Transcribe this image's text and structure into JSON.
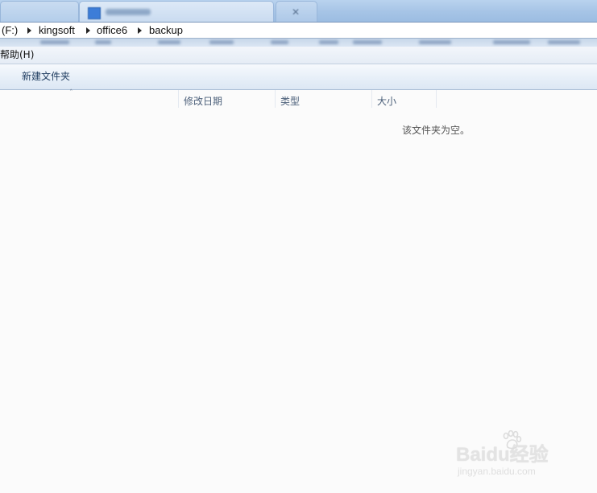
{
  "window": {
    "tabs": [
      {
        "state": "inactive"
      },
      {
        "state": "active",
        "icon": "folder-icon"
      },
      {
        "state": "inactive",
        "icon": "close-icon"
      }
    ],
    "close_glyph": "✕"
  },
  "address_bar": {
    "drive_partial": "(F:)",
    "path": [
      "kingsoft",
      "office6",
      "backup"
    ],
    "separator_icon": "chevron-right-icon"
  },
  "menu": {
    "help_label": "帮助(H)"
  },
  "toolbar": {
    "new_folder_label": "新建文件夹"
  },
  "columns": {
    "sort_indicator": "ˆ",
    "date_modified": "修改日期",
    "type": "类型",
    "size": "大小"
  },
  "main": {
    "empty_message": "该文件夹为空。"
  },
  "watermark": {
    "brand": "Baidu经验",
    "url": "jingyan.baidu.com"
  }
}
